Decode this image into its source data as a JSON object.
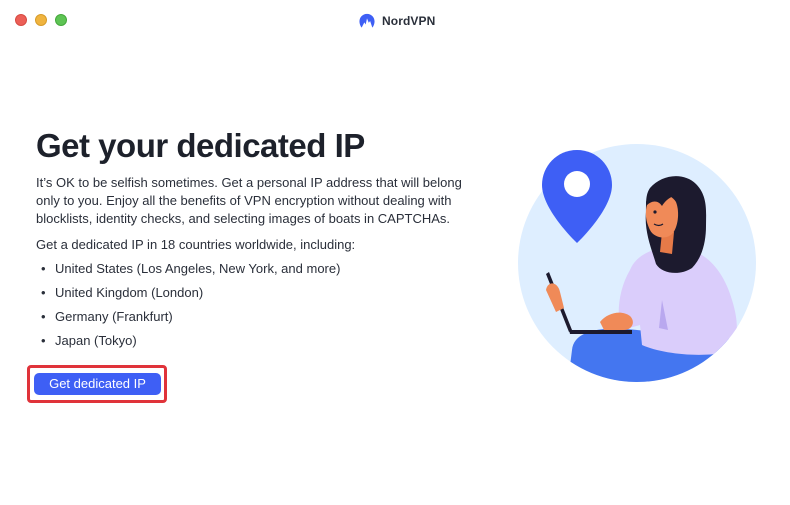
{
  "window": {
    "title": "NordVPN",
    "traffic_lights": [
      "close",
      "minimize",
      "maximize"
    ]
  },
  "main": {
    "heading": "Get your dedicated IP",
    "intro": "It’s OK to be selfish sometimes. Get a personal IP address that will belong only to you. Enjoy all the benefits of VPN encryption without dealing with blocklists, identity checks, and selecting images of boats in CAPTCHAs.",
    "countries_label": "Get a dedicated IP in 18 countries worldwide, including:",
    "countries": [
      "United States (Los Angeles, New York, and more)",
      "United Kingdom (London)",
      "Germany (Frankfurt)",
      "Japan (Tokyo)"
    ],
    "bullet": "•",
    "cta_label": "Get dedicated IP"
  },
  "illustration": {
    "icon": "location-pin-person-laptop",
    "colors": {
      "circle_bg": "#deeeff",
      "pin": "#3e5ff5",
      "hair": "#1c1a2e",
      "skin": "#f08a58",
      "shirt": "#dacdfb",
      "pants": "#4476f0"
    }
  },
  "colors": {
    "accent": "#3e5ff5",
    "highlight": "#e0333a"
  }
}
